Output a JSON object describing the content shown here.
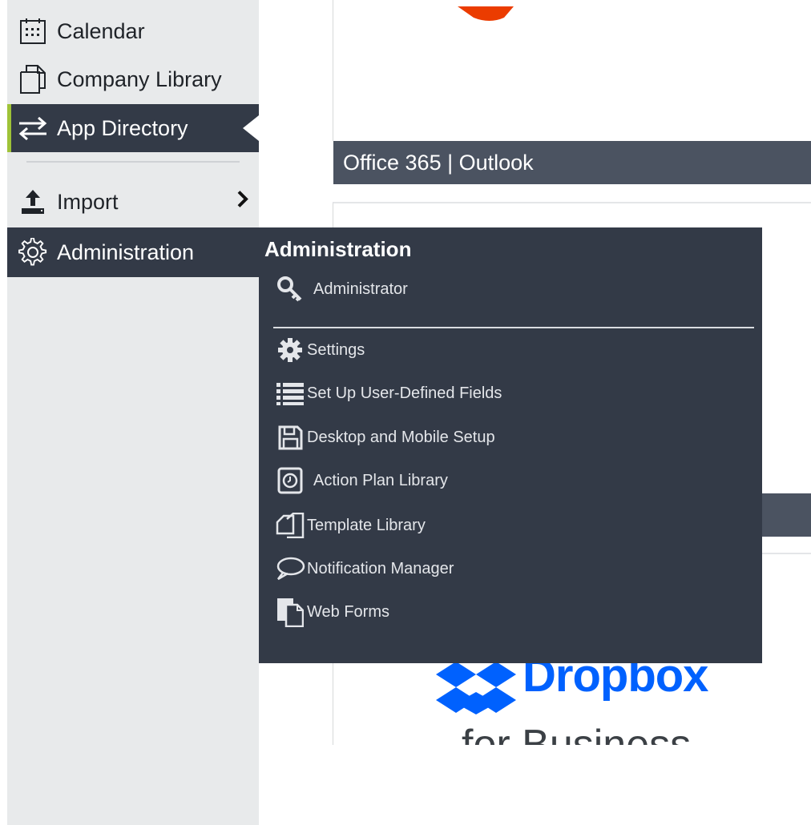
{
  "sidebar": {
    "items": [
      {
        "label": "Calendar",
        "icon": "calendar-icon"
      },
      {
        "label": "Company Library",
        "icon": "document-icon"
      },
      {
        "label": "App Directory",
        "icon": "swap-arrows-icon",
        "selected": true
      },
      {
        "label": "Import",
        "icon": "upload-icon",
        "has_submenu": true
      },
      {
        "label": "Administration",
        "icon": "gear-icon",
        "open": true
      }
    ]
  },
  "content": {
    "card1_title": "Office 365 | Outlook",
    "dropbox_brand": "Dropbox",
    "dropbox_sub": "for Business"
  },
  "flyout": {
    "title": "Administration",
    "items": [
      {
        "label": "Administrator",
        "icon": "key-icon"
      },
      {
        "label": "Settings",
        "icon": "gear-icon"
      },
      {
        "label": "Set Up User-Defined Fields",
        "icon": "list-icon"
      },
      {
        "label": "Desktop and Mobile Setup",
        "icon": "floppy-disk-icon"
      },
      {
        "label": "Action Plan Library",
        "icon": "clock-icon"
      },
      {
        "label": "Template Library",
        "icon": "copy-pages-icon"
      },
      {
        "label": "Notification Manager",
        "icon": "speech-bubble-icon"
      },
      {
        "label": "Web Forms",
        "icon": "forms-icon"
      }
    ]
  },
  "colors": {
    "sidebar_bg": "#e8eaeb",
    "dark_panel": "#333a47",
    "card_bar": "#4b5361",
    "accent_green": "#9fc338",
    "dropbox_blue": "#0061fe",
    "office_orange": "#eb3c00"
  }
}
